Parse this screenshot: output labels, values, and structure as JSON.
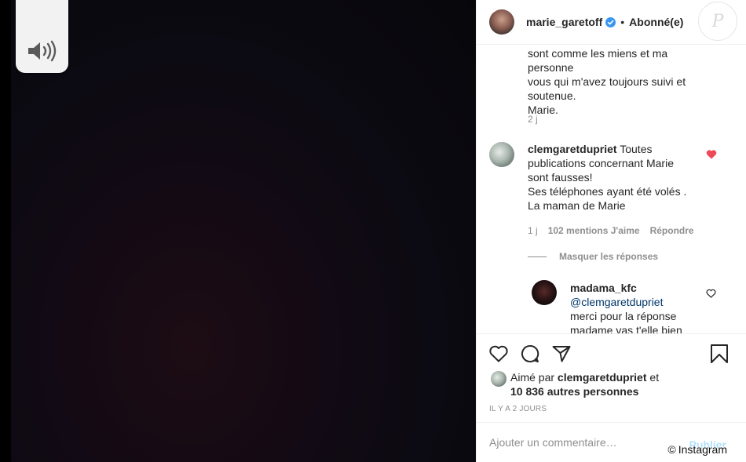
{
  "header": {
    "username": "marie_garetoff",
    "separator": "•",
    "follow_status": "Abonné(e)",
    "logo_letter": "P"
  },
  "comments": {
    "c1": {
      "lines": [
        "sont comme les miens et ma personne",
        "vous qui m'avez toujours suivi et",
        "soutenue.",
        "Marie."
      ],
      "time": "2 j"
    },
    "c2": {
      "username": "clemgaretdupriet",
      "lines": [
        " Toutes",
        "publications concernant Marie",
        "sont fausses!",
        "Ses téléphones ayant été volés .",
        "La maman de Marie"
      ],
      "time": "1 j",
      "likes": "102 mentions J'aime",
      "reply": "Répondre",
      "hide_replies": "Masquer les réponses"
    },
    "r1": {
      "username": "madama_kfc",
      "mention": "@clemgaretdupriet",
      "lines": [
        "merci pour la réponse",
        "madame vas t'elle bien"
      ]
    }
  },
  "likes": {
    "prefix": "Aimé par ",
    "user": "clemgaretdupriet",
    "suffix": " et",
    "others": "10 836 autres personnes"
  },
  "post_time": "Il y a 2 jours",
  "comment_box": {
    "placeholder": "Ajouter un commentaire…",
    "publish": "Publier"
  },
  "credit": {
    "symbol": "©",
    "text": "Instagram"
  },
  "colors": {
    "heart_liked": "#ed4956",
    "verified": "#3897f0",
    "link": "#00376b"
  }
}
